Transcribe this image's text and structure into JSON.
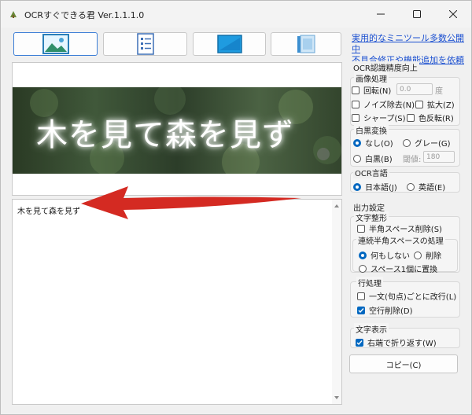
{
  "window": {
    "title": "OCRすぐできる君 Ver.1.1.1.0"
  },
  "links": {
    "link1": "実用的なミニツール多数公開中",
    "link2": "不具合修正や機能追加を依頼"
  },
  "image": {
    "text": "木を見て森を見ず"
  },
  "result": {
    "text": "木を見て森を見ず"
  },
  "ocr_panel": {
    "title": "OCR認識精度向上",
    "image_processing": {
      "title": "画像処理",
      "rotate": "回転(N)",
      "rotate_value": "0.0",
      "degree": "度",
      "denoise": "ノイズ除去(N)",
      "enlarge": "拡大(Z)",
      "sharpen": "シャープ(S)",
      "invert": "色反転(R)"
    },
    "bw": {
      "title": "白黒変換",
      "none": "なし(O)",
      "gray": "グレー(G)",
      "bw": "白黒(B)",
      "threshold_label": "閾値:",
      "threshold_value": "180"
    },
    "lang": {
      "title": "OCR言語",
      "ja": "日本語(J)",
      "en": "英語(E)"
    }
  },
  "output_panel": {
    "title": "出力設定",
    "format": {
      "title": "文字整形",
      "half_space": "半角スペース削除(S)",
      "consecutive": {
        "title": "連続半角スペースの処理",
        "nothing": "何もしない",
        "delete": "削除",
        "single": "スペース1個に置換"
      }
    },
    "line": {
      "title": "行処理",
      "per_sentence": "一文(句点)ごとに改行(L)",
      "blank": "空行削除(D)"
    },
    "display": {
      "title": "文字表示",
      "wrap": "右端で折り返す(W)"
    },
    "copy": "コピー(C)"
  }
}
